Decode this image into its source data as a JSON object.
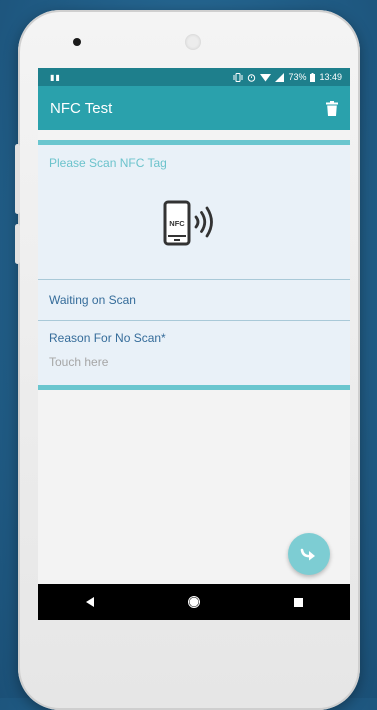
{
  "status_bar": {
    "left_icon": "notification-dots-icon",
    "battery": "73%",
    "time": "13:49"
  },
  "app_bar": {
    "title": "NFC Test",
    "action_icon": "trash-icon"
  },
  "scan_card": {
    "prompt": "Please Scan NFC Tag",
    "nfc_label": "NFC",
    "status": "Waiting on Scan"
  },
  "reason_field": {
    "label": "Reason For No Scan*",
    "placeholder": "Touch here"
  },
  "fab": {
    "icon": "return-arrow-icon"
  },
  "nav_bar": {
    "icons": [
      "back-icon",
      "home-icon",
      "recents-icon"
    ]
  },
  "colors": {
    "status_bar": "#1e7f8c",
    "app_bar": "#2aa1ac",
    "accent": "#6ac6cf",
    "label_blue": "#356c9a",
    "fab": "#7dcdd3"
  }
}
